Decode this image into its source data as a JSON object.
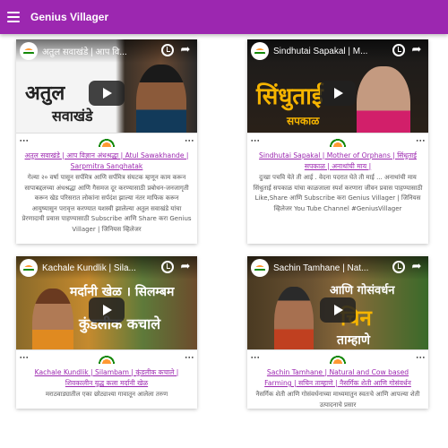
{
  "app": {
    "title": "Genius Villager",
    "menu_icon": "menu-icon"
  },
  "colors": {
    "primary": "#9c27b0",
    "title_link": "#9c27b0",
    "desc_text": "#5a5a5a"
  },
  "cards": [
    {
      "video_title": "अतुल सवाखंडे | आप वि...",
      "thumb_text": "अतुल",
      "thumb_sub": "सवाखंडे",
      "title": "अतुल सवाखंडे | आप विज्ञान अंधश्रद्धा | Atul Sawakhande | Sarpmitra Sanghatak",
      "desc": "गेल्या २० वर्षा पासून सर्पमित्र आणि सर्पमित्र संघटक म्हणून काम करून सापाबद्दलच्या अंधश्रद्धा आणि गैसमज दूर करण्यासाठी प्रबोधन-जनजागृती करून खेड परिसरात लोकांना सर्पदंश झाल्या नंतर माफिक करून आयुष्यासुन परावृत्त करण्यात यशस्वी झालेल्या अतुल सवाखंडे यांचा प्रेरणादायी प्रवास पाहण्यासाठी Subscribe आणि Share करा Genius Villager | जिनियस व्हिलेजर"
    },
    {
      "video_title": "Sindhutai Sapakal | M...",
      "thumb_text": "सिंधुताई",
      "thumb_sub": "सपकाळ",
      "title": "Sindhutai Sapakal | Mother of Orphans | सिंधुताई सपकाळ | अनाथांची माय |",
      "desc": "दुःखा पचवि येते ती आई . वेदना पदरात घेते ती माई ... अनाथांची माय सिंधुताई सपकाळ यांचा काळजाला स्पर्श करणारा जीवन प्रवास पाहण्यासाठी Like,Share आणि Subscribe करा Genius Villager | जिनियस व्हिलेजर You Tube Channel #GeniusVillager"
    },
    {
      "video_title": "Kachale Kundlik | Sila...",
      "thumb_text": "मर्दानी खेळ । सिलम्बम",
      "thumb_sub": "कुंडलीक कचाले",
      "title": "Kachale Kundlik | Silambam | कुंडलीक कचाले | शिवकालीन युद्ध कला मर्दानी खेळ",
      "desc": "मराठवाड्यातील एका छोट्याश्या गावातून आलेला तरुण"
    },
    {
      "video_title": "Sachin Tamhane | Nat...",
      "thumb_text": "आणि गोसंवर्धन",
      "thumb_sub": "चिन",
      "thumb_sub2": "ताम्हाणे",
      "title": "Sachin Tamhane | Natural and Cow based Farming | सचिन ताम्हाणे | नैसर्गिक शेती आणि गोसंवर्धन",
      "desc": "नैसर्गिक शेती आणि गोसंवर्धनाच्या माध्यमातुन स्वतःचे आणि आपल्या शेती उत्पादनाचे प्रसार"
    }
  ]
}
